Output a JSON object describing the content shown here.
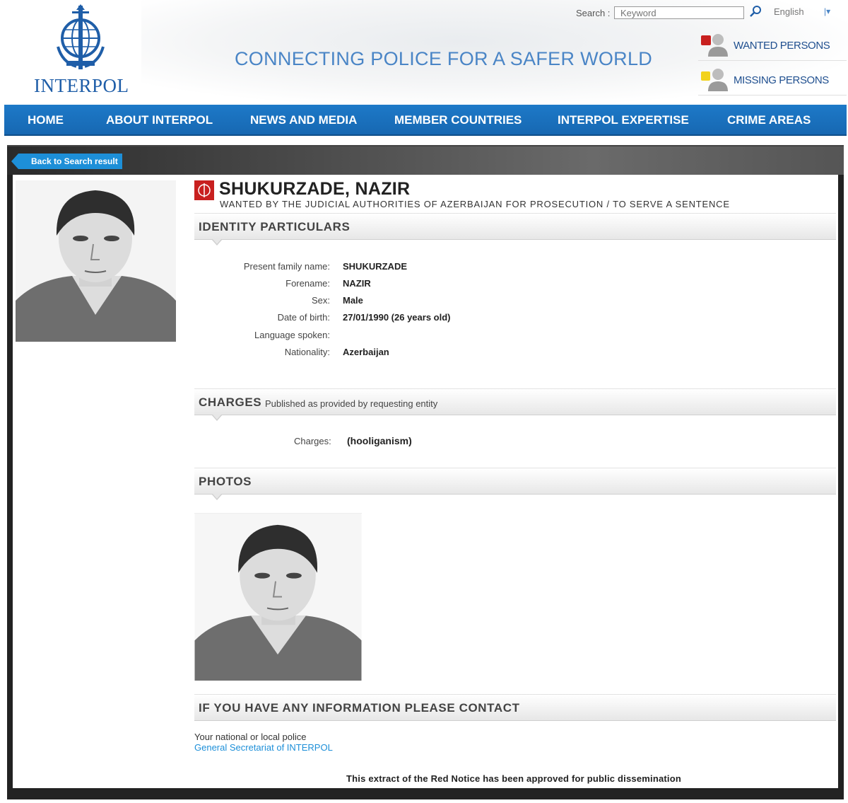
{
  "header": {
    "logo_text": "INTERPOL",
    "tagline": "CONNECTING POLICE FOR A SAFER WORLD",
    "search_label": "Search :",
    "search_placeholder": "Keyword",
    "language": "English",
    "quick_links": [
      "WANTED PERSONS",
      "MISSING PERSONS"
    ]
  },
  "nav": [
    "HOME",
    "ABOUT INTERPOL",
    "NEWS AND MEDIA",
    "MEMBER COUNTRIES",
    "INTERPOL EXPERTISE",
    "CRIME AREAS"
  ],
  "back_button": "Back to Search result",
  "person": {
    "name": "SHUKURZADE, NAZIR",
    "wanted_by": "WANTED BY THE JUDICIAL AUTHORITIES OF AZERBAIJAN FOR PROSECUTION / TO SERVE A SENTENCE"
  },
  "identity": {
    "title": "IDENTITY PARTICULARS",
    "fields": [
      {
        "label": "Present family name:",
        "value": "SHUKURZADE"
      },
      {
        "label": "Forename:",
        "value": "NAZIR"
      },
      {
        "label": "Sex:",
        "value": "Male"
      },
      {
        "label": "Date of birth:",
        "value": "27/01/1990 (26 years old)"
      },
      {
        "label": "Language spoken:",
        "value": ""
      },
      {
        "label": "Nationality:",
        "value": "Azerbaijan"
      }
    ]
  },
  "charges": {
    "title": "CHARGES",
    "subtitle": "Published as provided by requesting entity",
    "label": "Charges:",
    "value": "(hooliganism)"
  },
  "photos": {
    "title": "PHOTOS"
  },
  "contact": {
    "title": "IF YOU HAVE ANY INFORMATION PLEASE CONTACT",
    "line1": "Your national or local police",
    "line2": "General Secretariat of INTERPOL"
  },
  "disclaimer": "This extract of the Red Notice has been approved for public dissemination",
  "colors": {
    "nav": "#1768b2",
    "link": "#1d8fd8",
    "brand": "#1f5ea8",
    "notice_red": "#c8201f"
  }
}
